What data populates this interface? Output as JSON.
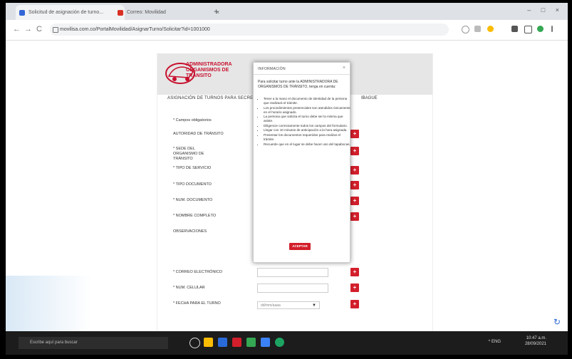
{
  "browser": {
    "tabs": [
      {
        "label": "Solicitud de asignación de turno...",
        "active": true,
        "favicon_color": "#3367d6"
      },
      {
        "label": "Correo: Movilidad",
        "active": false,
        "favicon_color": "#d93025"
      }
    ],
    "new_tab": "+",
    "window_controls": "– □ ×",
    "url": "movilisa.com.co/PortalMovilidad/AsignarTurno/Solicitar?id=1001000",
    "nav": {
      "back": "←",
      "forward": "→",
      "reload": "C"
    }
  },
  "page": {
    "logo_text": "Administradora Organismos de Tránsito",
    "form_title": "ASIGNACIÓN DE TURNOS PARA SECRETARÍA DE TRÁNSITO",
    "form_title_right": "IBAGUE",
    "fields": [
      {
        "label": "* Campos obligatorios",
        "has_add": false,
        "has_input": false
      },
      {
        "label": "AUTORIDAD DE TRÁNSITO",
        "has_add": true,
        "has_input": false
      },
      {
        "label": "* SEDE DEL ORGANISMO DE TRÁNSITO",
        "has_add": true,
        "has_input": false
      },
      {
        "label": "* TIPO DE SERVICIO",
        "has_add": true,
        "has_input": false
      },
      {
        "label": "* TIPO DOCUMENTO",
        "has_add": true,
        "has_input": false
      },
      {
        "label": "* NUM. DOCUMENTO",
        "has_add": true,
        "has_input": false
      },
      {
        "label": "* NOMBRE COMPLETO",
        "has_add": true,
        "has_input": false
      },
      {
        "label": "OBSERVACIONES",
        "has_add": false,
        "has_input": false
      },
      {
        "label": "* CORREO ELECTRÓNICO",
        "has_add": true,
        "has_input": true
      },
      {
        "label": "* NUM. CELULAR",
        "has_add": true,
        "has_input": true
      },
      {
        "label": "* FECHA PARA EL TURNO",
        "has_add": true,
        "has_input": false
      }
    ],
    "date_placeholder": "dd/mm/aaaa",
    "add_symbol": "+"
  },
  "modal": {
    "title": "INFORMACIÓN",
    "close": "×",
    "intro": "Para solicitar turno ante la ADMINISTRADORA DE ORGANISMOS DE TRÁNSITO, tenga en cuenta:",
    "items": [
      "Tener a la mano el documento de identidad de la persona que realizará el trámite.",
      "Los procedimientos presenciales son atendidos únicamente en el horario asignado.",
      "La persona que solicita el turno debe ser la misma que asiste.",
      "Diligencie correctamente todos los campos del formulario.",
      "Llegar con 10 minutos de anticipación a la hora asignada.",
      "Presentar los documentos requeridos para realizar el trámite.",
      "Recuerde que en el lugar se debe hacer uso del tapabocas."
    ],
    "accept_label": "ACEPTAR"
  },
  "taskbar": {
    "search_placeholder": "Escribe aquí para buscar",
    "time": "10:47 a.m.",
    "date": "28/09/2021",
    "tray": "^ ENG"
  },
  "colors": {
    "accent": "#d21f2b",
    "header_bg": "#e6e6e6",
    "taskbar": "#1c1c1c"
  }
}
